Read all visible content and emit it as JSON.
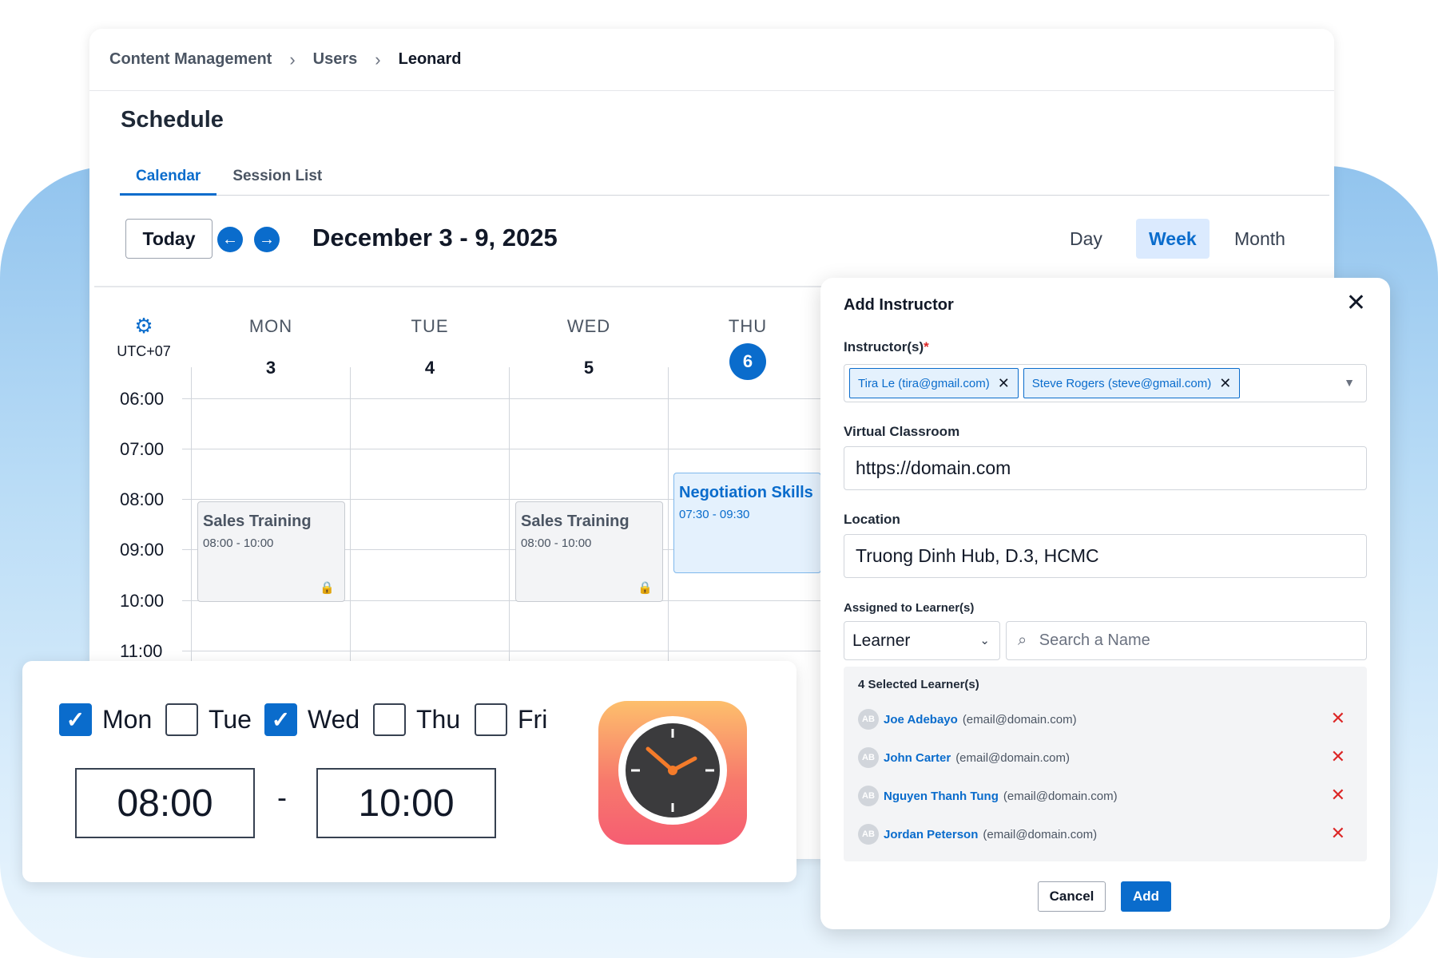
{
  "breadcrumb": [
    "Content Management",
    "Users",
    "Leonard"
  ],
  "page_title": "Schedule",
  "tabs": [
    {
      "label": "Calendar",
      "active": true
    },
    {
      "label": "Session List",
      "active": false
    }
  ],
  "toolbar": {
    "today_label": "Today",
    "prev_icon": "arrow-left-icon",
    "next_icon": "arrow-right-icon",
    "date_range": "December 3 - 9, 2025",
    "views": [
      {
        "label": "Day"
      },
      {
        "label": "Week",
        "active": true
      },
      {
        "label": "Month"
      }
    ]
  },
  "calendar": {
    "timezone": "UTC+07",
    "days": [
      {
        "name": "MON",
        "date": "3"
      },
      {
        "name": "TUE",
        "date": "4"
      },
      {
        "name": "WED",
        "date": "5"
      },
      {
        "name": "THU",
        "date": "6",
        "today": true
      }
    ],
    "hours": [
      "06:00",
      "07:00",
      "08:00",
      "09:00",
      "10:00",
      "11:00"
    ],
    "events": [
      {
        "title": "Sales Training",
        "time": "08:00 - 10:00",
        "locked": true
      },
      {
        "title": "Sales Training",
        "time": "08:00 - 10:00",
        "locked": true
      },
      {
        "title": "Negotiation Skills",
        "time": "07:30 - 09:30",
        "locked": false
      }
    ]
  },
  "repeat_panel": {
    "days": [
      {
        "label": "Mon",
        "checked": true
      },
      {
        "label": "Tue",
        "checked": false
      },
      {
        "label": "Wed",
        "checked": true
      },
      {
        "label": "Thu",
        "checked": false
      },
      {
        "label": "Fri",
        "checked": false
      }
    ],
    "start_time": "08:00",
    "separator": "-",
    "end_time": "10:00",
    "app_icon": "clock-icon"
  },
  "dialog": {
    "title": "Add Instructor",
    "close_icon": "close-icon",
    "instructors_label": "Instructor(s)",
    "required_mark": "*",
    "instructors": [
      "Tira Le (tira@gmail.com)",
      "Steve Rogers (steve@gmail.com)"
    ],
    "virtual_classroom_label": "Virtual Classroom",
    "virtual_classroom_value": "https://domain.com",
    "location_label": "Location",
    "location_value": "Truong Dinh Hub, D.3, HCMC",
    "assigned_label": "Assigned to Learner(s)",
    "learner_type": "Learner",
    "search_placeholder": "Search a Name",
    "selected_count": "4 Selected Learner(s)",
    "learners": [
      {
        "initials": "AB",
        "name": "Joe Adebayo",
        "email": "(email@domain.com)"
      },
      {
        "initials": "AB",
        "name": "John Carter",
        "email": "(email@domain.com)"
      },
      {
        "initials": "AB",
        "name": "Nguyen Thanh Tung",
        "email": "(email@domain.com)"
      },
      {
        "initials": "AB",
        "name": "Jordan Peterson",
        "email": "(email@domain.com)"
      }
    ],
    "cancel_label": "Cancel",
    "add_label": "Add"
  },
  "colors": {
    "accent": "#0a6ccc",
    "danger": "#dc2626",
    "event_blue_bg": "#e4f1fd",
    "event_gray_bg": "#f3f4f6"
  }
}
